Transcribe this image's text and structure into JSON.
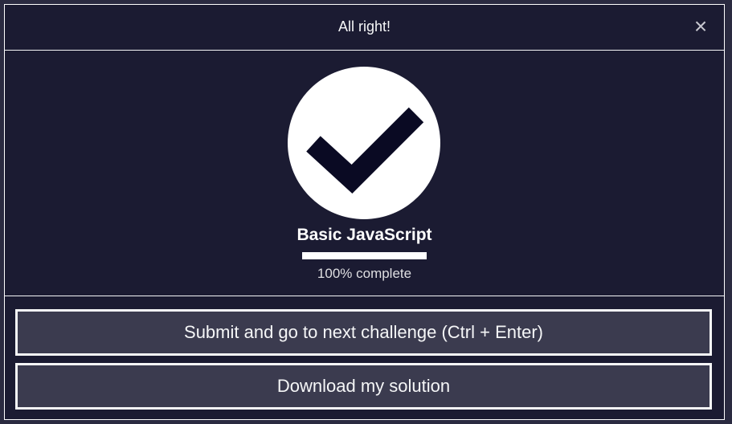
{
  "modal": {
    "title": "All right!",
    "close_symbol": "×",
    "close_icon": "close-icon"
  },
  "course": {
    "title": "Basic JavaScript",
    "progress_percent": 100,
    "progress_text": "100% complete",
    "badge_icon": "checkmark-icon"
  },
  "actions": {
    "submit_label": "Submit and go to next challenge (Ctrl + Enter)",
    "download_label": "Download my solution"
  },
  "colors": {
    "background": "#1b1b32",
    "button_bg": "#3b3b4f",
    "foreground": "#f5f6f7",
    "check_stroke": "#0a0a23"
  }
}
